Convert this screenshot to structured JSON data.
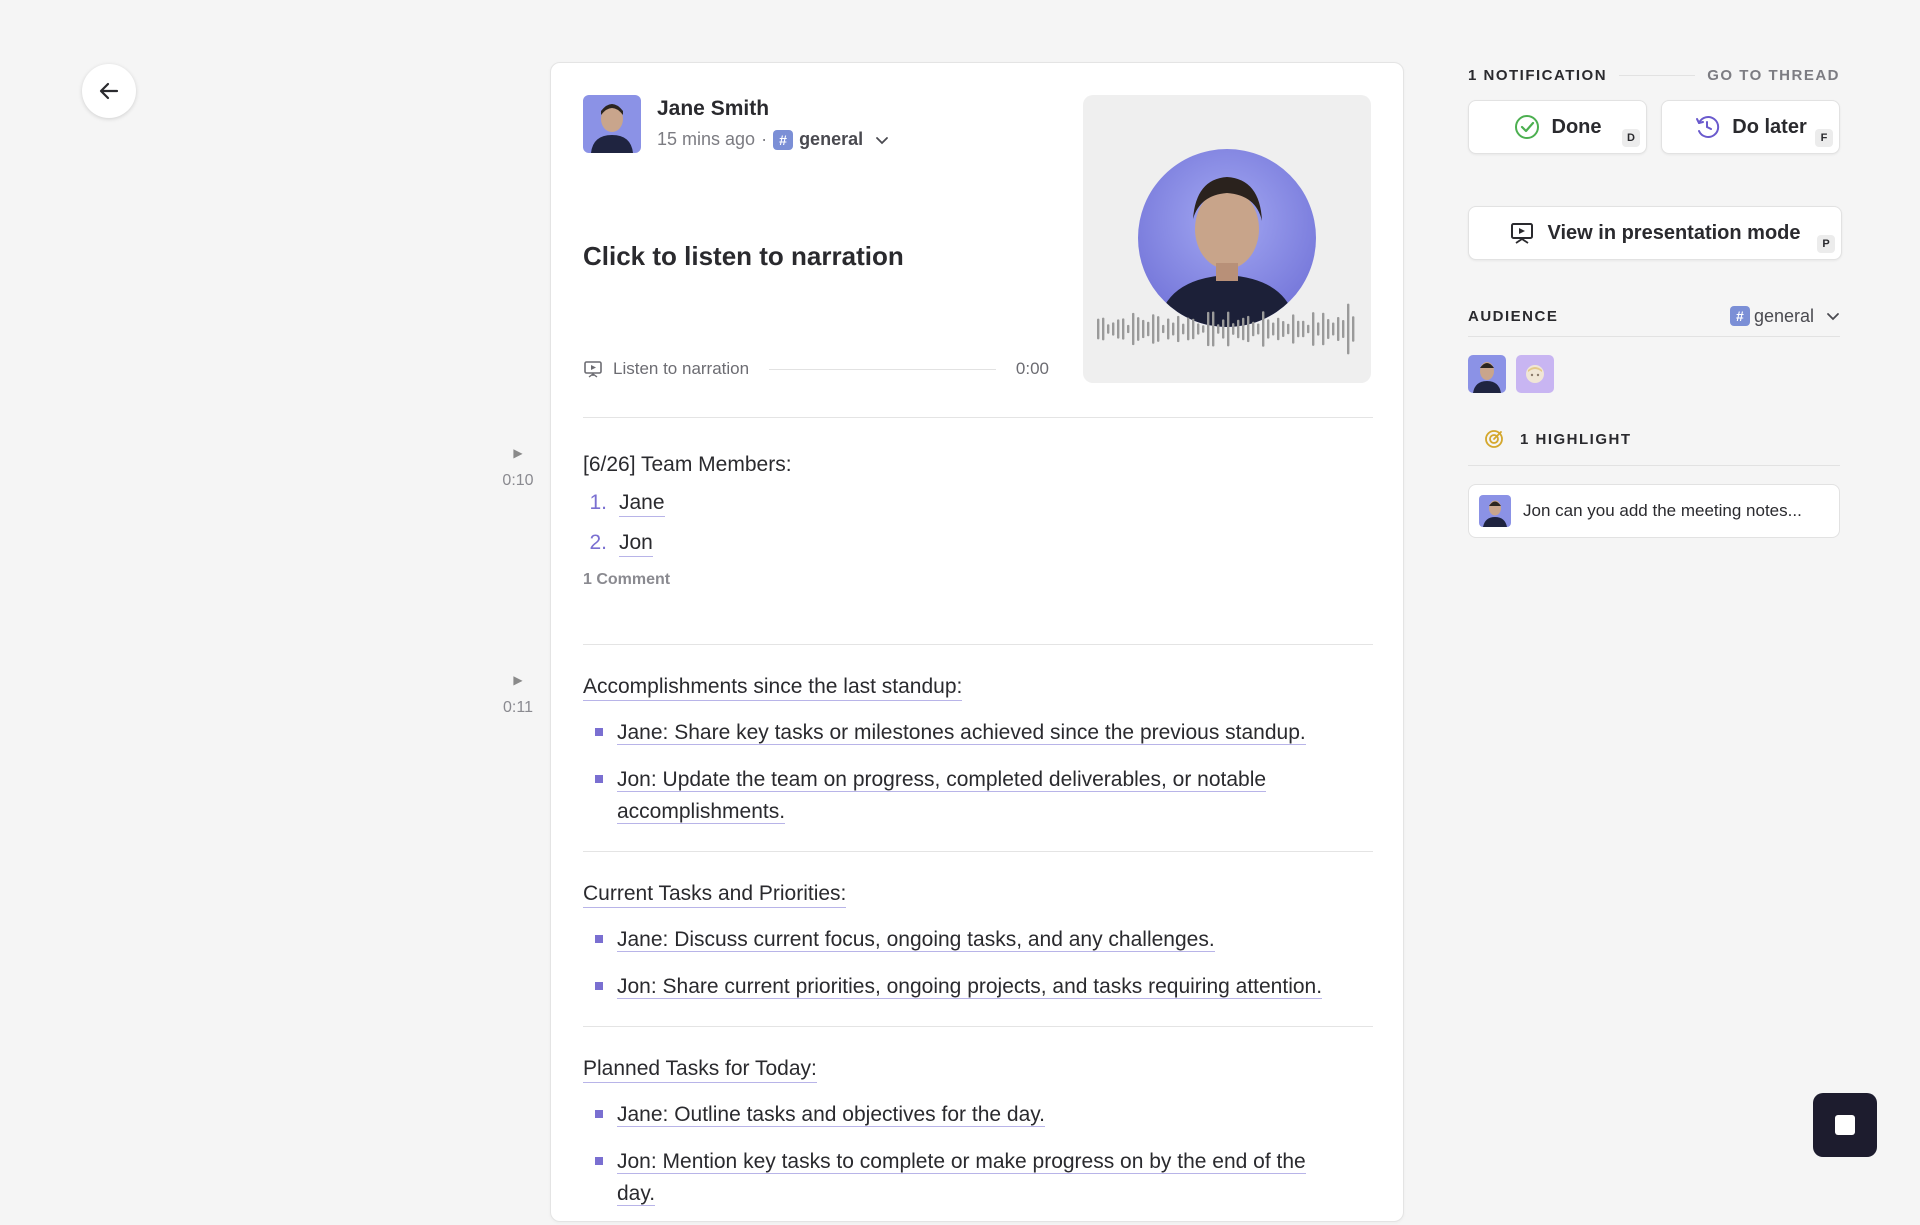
{
  "post": {
    "author": "Jane Smith",
    "time": "15 mins ago",
    "separator": "·",
    "channel_hash": "#",
    "channel": "general",
    "narration_title": "Click to listen to narration",
    "narration_label": "Listen to narration",
    "narration_time": "0:00"
  },
  "timestamps": [
    "0:10",
    "0:11"
  ],
  "sections": {
    "team": {
      "heading": "[6/26] Team Members:",
      "members": [
        {
          "num": "1.",
          "name": "Jane"
        },
        {
          "num": "2.",
          "name": "Jon"
        }
      ],
      "comment_count": "1 Comment"
    },
    "accomplishments": {
      "heading": "Accomplishments since the last standup:",
      "items": [
        "Jane: Share key tasks or milestones achieved since the previous standup.",
        "Jon: Update the team on progress, completed deliverables, or notable accomplishments."
      ]
    },
    "current": {
      "heading": "Current Tasks and Priorities:",
      "items": [
        "Jane: Discuss current focus, ongoing tasks, and any challenges.",
        "Jon: Share current priorities, ongoing projects, and tasks requiring attention."
      ]
    },
    "planned": {
      "heading": "Planned Tasks for Today:",
      "items": [
        "Jane: Outline tasks and objectives for the day.",
        "Jon: Mention key tasks to complete or make progress on by the end of the day."
      ]
    }
  },
  "sidebar": {
    "notification_label": "1 NOTIFICATION",
    "go_to_thread": "GO TO THREAD",
    "done_label": "Done",
    "done_key": "D",
    "later_label": "Do later",
    "later_key": "F",
    "present_label": "View in presentation mode",
    "present_key": "P",
    "audience_label": "AUDIENCE",
    "audience_hash": "#",
    "audience_channel": "general",
    "highlight_label": "1 HIGHLIGHT",
    "highlight_text": "Jon can you add the meeting notes..."
  },
  "colors": {
    "accent": "#7a6fd1",
    "done_green": "#4caf50",
    "later_purple": "#6a5acd",
    "stop_button": "#1d1c2e"
  }
}
